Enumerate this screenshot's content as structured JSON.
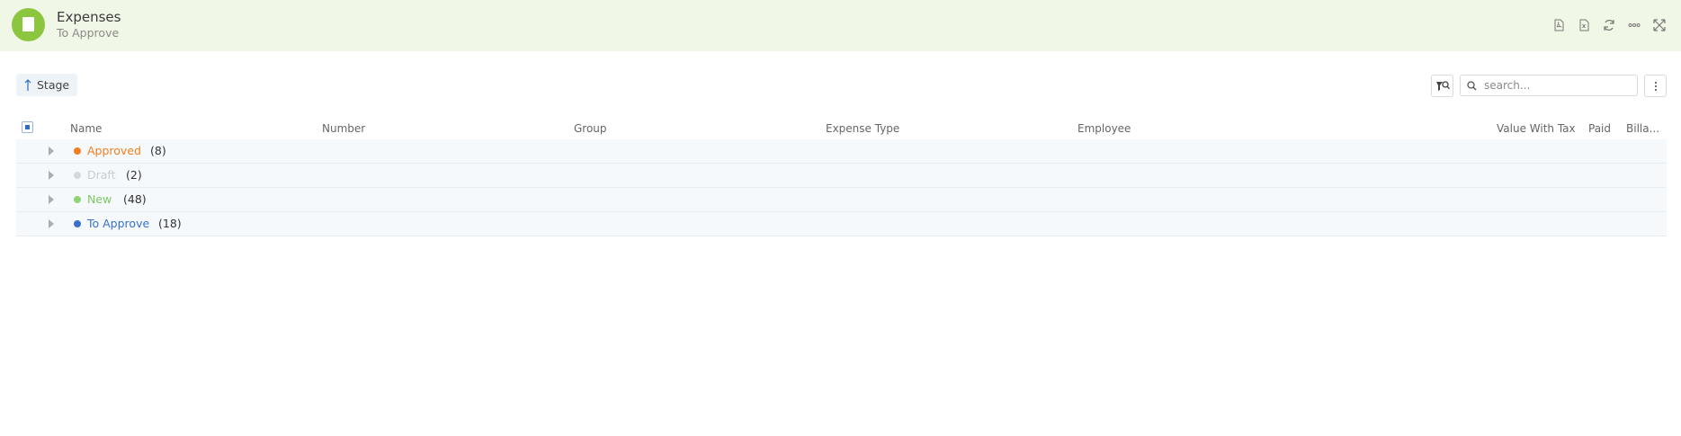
{
  "header": {
    "title": "Expenses",
    "subtitle": "To Approve",
    "actions": [
      "pdf-icon",
      "excel-icon",
      "refresh-icon",
      "more-horizontal-icon",
      "expand-icon"
    ]
  },
  "toolbar": {
    "sort_label": "Stage",
    "search_placeholder": "search..."
  },
  "table": {
    "columns": [
      "Name",
      "Number",
      "Group",
      "Expense Type",
      "Employee",
      "Value With Tax",
      "Paid",
      "Billa..."
    ]
  },
  "groups": [
    {
      "label": "Approved",
      "count": "(8)",
      "color": "#f07f1d"
    },
    {
      "label": "Draft",
      "count": "(2)",
      "color": "#d6d9dc"
    },
    {
      "label": "New",
      "count": "(48)",
      "color": "#8fd476"
    },
    {
      "label": "To Approve",
      "count": "(18)",
      "color": "#3a6fcf"
    }
  ],
  "colors": {
    "header_bg": "#f1f7e6",
    "app_icon": "#8cc63f",
    "row_bg": "#f5f9fc"
  }
}
